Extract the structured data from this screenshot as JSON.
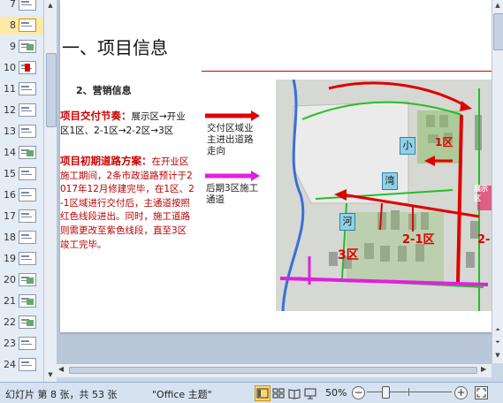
{
  "thumbnails": {
    "current": "8",
    "items": [
      {
        "number": "7",
        "icon": "slide-thumbnail-icon"
      },
      {
        "number": "8",
        "icon": "slide-thumbnail-icon"
      },
      {
        "number": "9",
        "icon": "slide-thumbnail-icon"
      },
      {
        "number": "10",
        "icon": "slide-thumbnail-icon"
      },
      {
        "number": "11",
        "icon": "slide-thumbnail-icon"
      },
      {
        "number": "12",
        "icon": "slide-thumbnail-icon"
      },
      {
        "number": "13",
        "icon": "slide-thumbnail-icon"
      },
      {
        "number": "14",
        "icon": "slide-thumbnail-icon"
      },
      {
        "number": "15",
        "icon": "slide-thumbnail-icon"
      },
      {
        "number": "16",
        "icon": "slide-thumbnail-icon"
      },
      {
        "number": "17",
        "icon": "slide-thumbnail-icon"
      },
      {
        "number": "18",
        "icon": "slide-thumbnail-icon"
      },
      {
        "number": "19",
        "icon": "slide-thumbnail-icon"
      },
      {
        "number": "20",
        "icon": "slide-thumbnail-icon"
      },
      {
        "number": "21",
        "icon": "slide-thumbnail-icon"
      },
      {
        "number": "22",
        "icon": "slide-thumbnail-icon"
      },
      {
        "number": "23",
        "icon": "slide-thumbnail-icon"
      },
      {
        "number": "24",
        "icon": "slide-thumbnail-icon"
      }
    ]
  },
  "slide": {
    "title": "一、项目信息",
    "section_heading": "2、营销信息",
    "para1_highlight": "项目交付节奏：",
    "para1_body": "展示区→开业区1区、2-1区→2-2区→3区",
    "para2_highlight": "项目初期道路方案：",
    "para2_body": "在开业区施工期间，2条市政道路预计于2017年12月修建完毕，在1区、2-1区域进行交付后，主通道按照红色线段进出。同时，施工道路则需更改至紫色线段，直至3区竣工完毕。",
    "legend": {
      "red_label": "交付区域业主进出道路走向",
      "purple_label": "后期3区施工通道"
    },
    "map": {
      "labels": {
        "zone1": "1区",
        "zone21": "2-1区",
        "zone2": "2-",
        "zone3": "3区",
        "showroom": "展示区"
      },
      "badges": {
        "small": "小",
        "bay": "湾",
        "river": "河"
      }
    }
  },
  "status": {
    "slide_info": "幻灯片 第 8 张，共 53 张",
    "theme": "\"Office 主题\"",
    "zoom": "50%",
    "zoom_level_percent": 50
  },
  "colors": {
    "accent": "#cc0000",
    "purple_route": "#d020d0",
    "green_road": "#22c022",
    "blue_river": "#3a6fd8"
  }
}
